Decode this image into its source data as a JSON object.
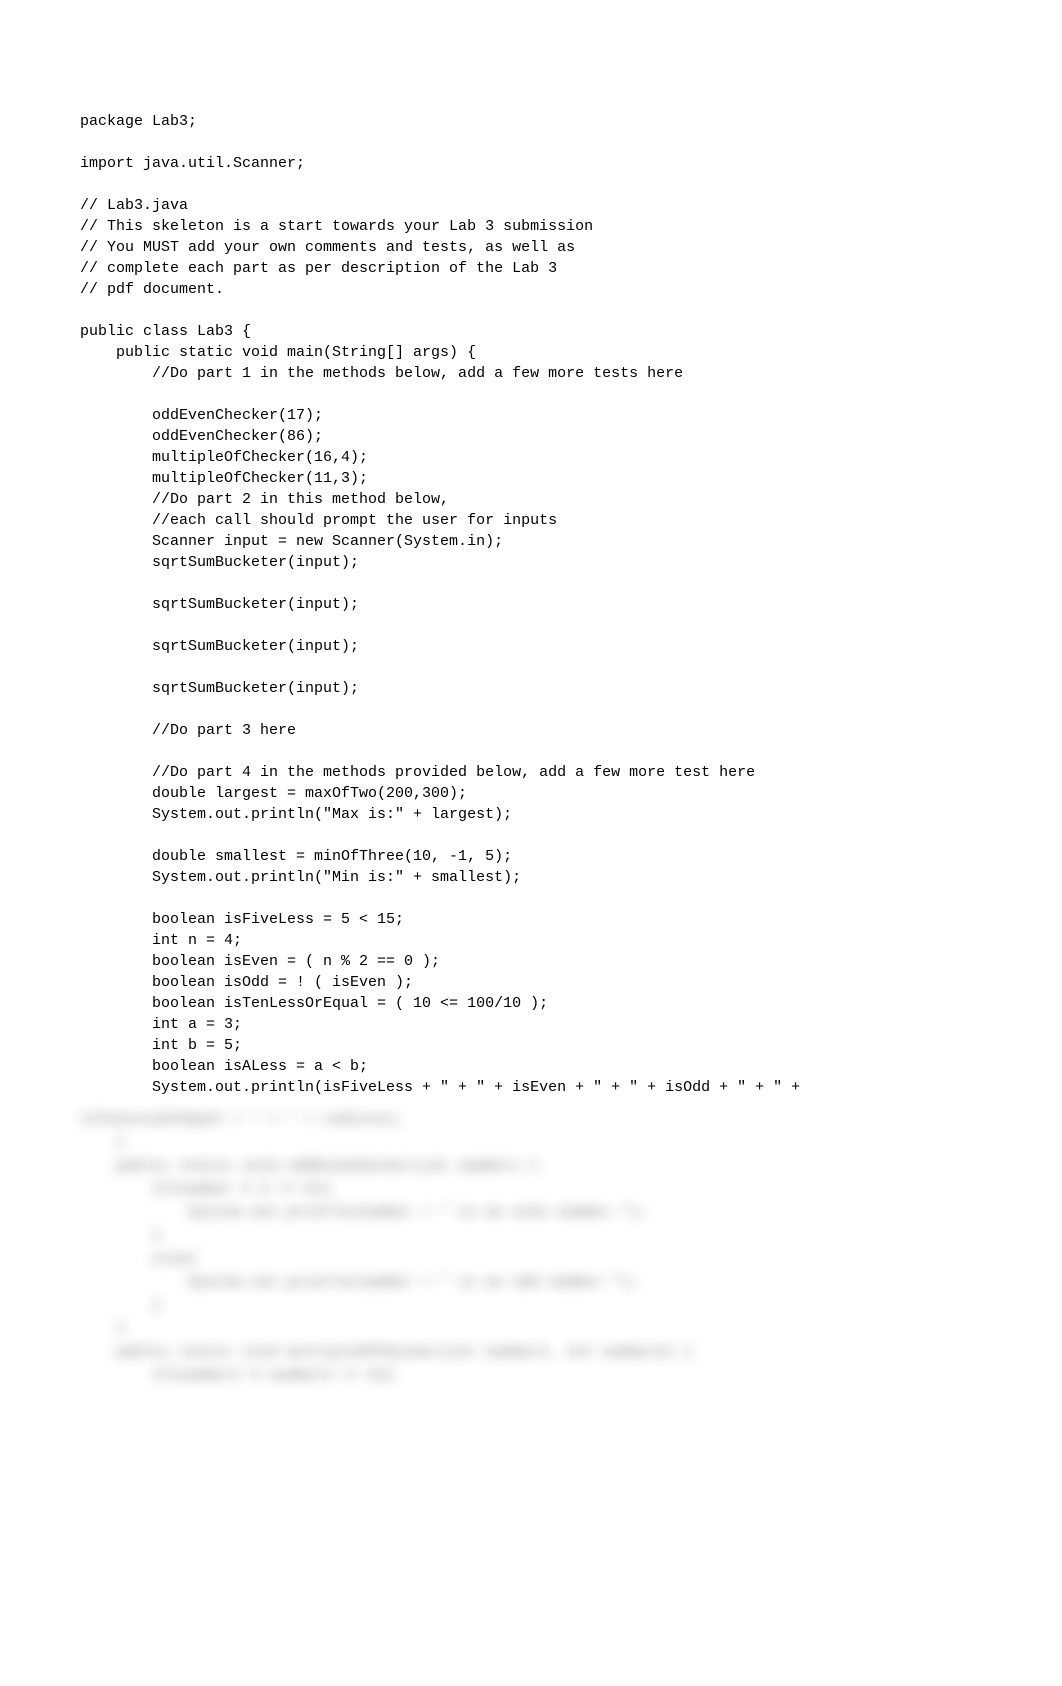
{
  "code": {
    "lines": [
      "package Lab3;",
      "",
      "import java.util.Scanner;",
      "",
      "// Lab3.java",
      "// This skeleton is a start towards your Lab 3 submission",
      "// You MUST add your own comments and tests, as well as",
      "// complete each part as per description of the Lab 3",
      "// pdf document.",
      "",
      "public class Lab3 {",
      "    public static void main(String[] args) {",
      "        //Do part 1 in the methods below, add a few more tests here",
      "",
      "        oddEvenChecker(17);",
      "        oddEvenChecker(86);",
      "        multipleOfChecker(16,4);",
      "        multipleOfChecker(11,3);",
      "        //Do part 2 in this method below,",
      "        //each call should prompt the user for inputs",
      "        Scanner input = new Scanner(System.in);",
      "        sqrtSumBucketer(input);",
      "",
      "        sqrtSumBucketer(input);",
      "",
      "        sqrtSumBucketer(input);",
      "",
      "        sqrtSumBucketer(input);",
      "",
      "        //Do part 3 here",
      "",
      "        //Do part 4 in the methods provided below, add a few more test here",
      "        double largest = maxOfTwo(200,300);",
      "        System.out.println(\"Max is:\" + largest);",
      "",
      "        double smallest = minOfThree(10, -1, 5);",
      "        System.out.println(\"Min is:\" + smallest);",
      "",
      "        boolean isFiveLess = 5 < 15;",
      "        int n = 4;",
      "        boolean isEven = ( n % 2 == 0 );",
      "        boolean isOdd = ! ( isEven );",
      "        boolean isTenLessOrEqual = ( 10 <= 100/10 );",
      "        int a = 3;",
      "        int b = 5;",
      "        boolean isALess = a < b;",
      "        System.out.println(isFiveLess + \" + \" + isEven + \" + \" + isOdd + \" + \" +"
    ]
  },
  "blurred": {
    "lines": [
      "isTenLessOrEqual + \" + \" + isALess);",
      "    }",
      "",
      "    public static void oddEvenChecker(int number) {",
      "",
      "        if(number % 2 == 0){",
      "            System.out.println(number + \" is an even number.\");",
      "        }",
      "        else{",
      "            System.out.println(number + \" is an odd number.\");",
      "        }",
      "",
      "    }",
      "",
      "    public static void multipleOfChecker(int number1, int number2) {",
      "",
      "        if(number1 % number2 == 0){"
    ]
  }
}
